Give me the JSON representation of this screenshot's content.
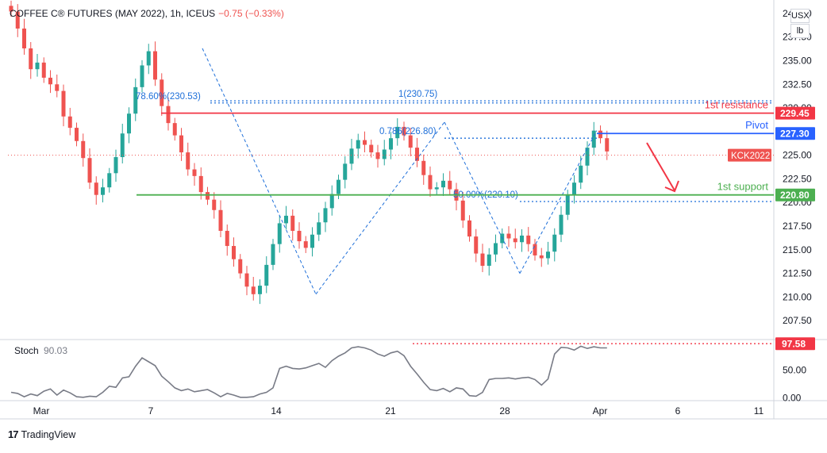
{
  "header": {
    "symbol": "COFFEE C® FUTURES (MAY 2022), 1h, ICEUS",
    "change": "−0.75 (−0.33%)"
  },
  "unit": {
    "currency": "USX",
    "measure": "lb"
  },
  "footer": {
    "brand": "TradingView"
  },
  "colors": {
    "up": "#26a69a",
    "down": "#ef5350",
    "resistance": "#f23645",
    "pivot": "#2962ff",
    "support": "#4caf50",
    "fib": "#1e6fd9",
    "stoch": "#787b86",
    "stoch_level": "#f23645"
  },
  "chart_data": [
    {
      "type": "line",
      "subtype": "candlestick",
      "x_ticks": [
        "Mar",
        "7",
        "14",
        "21",
        "28",
        "Apr",
        "6",
        "11"
      ],
      "y_ticks": [
        "207.50",
        "210.00",
        "212.50",
        "215.00",
        "217.50",
        "220.00",
        "222.50",
        "225.00",
        "227.50",
        "230.00",
        "232.50",
        "235.00",
        "237.50",
        "240.00"
      ],
      "ylim": [
        205.5,
        241
      ],
      "series": [
        {
          "values": [
            240.2,
            238.4,
            236.3,
            234.1,
            234.8,
            233.2,
            232.5,
            231.8,
            229.1,
            227.9,
            226.5,
            224.7,
            222.1,
            220.8,
            221.6,
            223.1,
            224.8,
            227.3,
            229.4,
            232.2,
            234.5,
            236.0,
            233.0,
            230.2,
            228.4,
            227.1,
            225.3,
            223.5,
            222.8,
            221.1,
            220.3,
            219.2,
            217.0,
            215.4,
            214.0,
            212.5,
            211.1,
            210.3,
            211.2,
            213.4,
            215.6,
            217.8,
            218.6,
            217.0,
            215.9,
            215.2,
            216.6,
            217.9,
            219.4,
            220.9,
            222.4,
            224.1,
            225.7,
            226.6,
            226.1,
            225.3,
            224.6,
            225.6,
            226.8,
            228.0,
            227.1,
            225.8,
            224.4,
            222.9,
            221.4,
            221.6,
            222.3,
            221.4,
            220.2,
            218.1,
            216.4,
            214.6,
            213.3,
            214.5,
            215.7,
            216.7,
            216.2,
            215.8,
            216.5,
            215.6,
            214.4,
            214.1,
            214.8,
            216.6,
            218.7,
            220.8,
            222.1,
            223.9,
            225.8,
            227.6,
            226.8,
            225.4
          ]
        }
      ],
      "levels": [
        {
          "label": "1st resistance",
          "value": 229.45,
          "price_label": "229.45"
        },
        {
          "label": "Pivot",
          "value": 227.3,
          "price_label": "227.30"
        },
        {
          "label": "1st support",
          "value": 220.8,
          "price_label": "220.80"
        }
      ],
      "current_price": {
        "label": "KCK2022",
        "value": 225.0
      },
      "fib_annotations": [
        {
          "text": "78.60%(230.53)",
          "value": 230.53
        },
        {
          "text": "1(230.75)",
          "value": 230.75
        },
        {
          "text": "0.786(226.80)",
          "value": 226.8
        },
        {
          "text": "50.00%(220.10)",
          "value": 220.1
        }
      ]
    },
    {
      "type": "line",
      "title": "Stoch",
      "current_value": "90.03",
      "y_ticks": [
        "0.00",
        "50.00"
      ],
      "ylim": [
        -5,
        105
      ],
      "series": [
        {
          "values": [
            10,
            8,
            2,
            7,
            4,
            12,
            16,
            5,
            14,
            9,
            2,
            1,
            3,
            2,
            10,
            21,
            19,
            36,
            38,
            57,
            72,
            65,
            58,
            39,
            29,
            18,
            13,
            16,
            11,
            13,
            15,
            9,
            2,
            8,
            5,
            1,
            1,
            2,
            7,
            10,
            18,
            53,
            57,
            53,
            52,
            54,
            58,
            62,
            55,
            67,
            75,
            81,
            90,
            92,
            90,
            86,
            79,
            75,
            81,
            84,
            76,
            57,
            43,
            28,
            15,
            13,
            17,
            11,
            18,
            16,
            4,
            3,
            10,
            33,
            35,
            35,
            36,
            34,
            36,
            37,
            33,
            23,
            34,
            79,
            91,
            90,
            86,
            93,
            89,
            92,
            90,
            90
          ]
        }
      ],
      "levels": [
        {
          "value": 97.58,
          "price_label": "97.58"
        }
      ]
    }
  ]
}
